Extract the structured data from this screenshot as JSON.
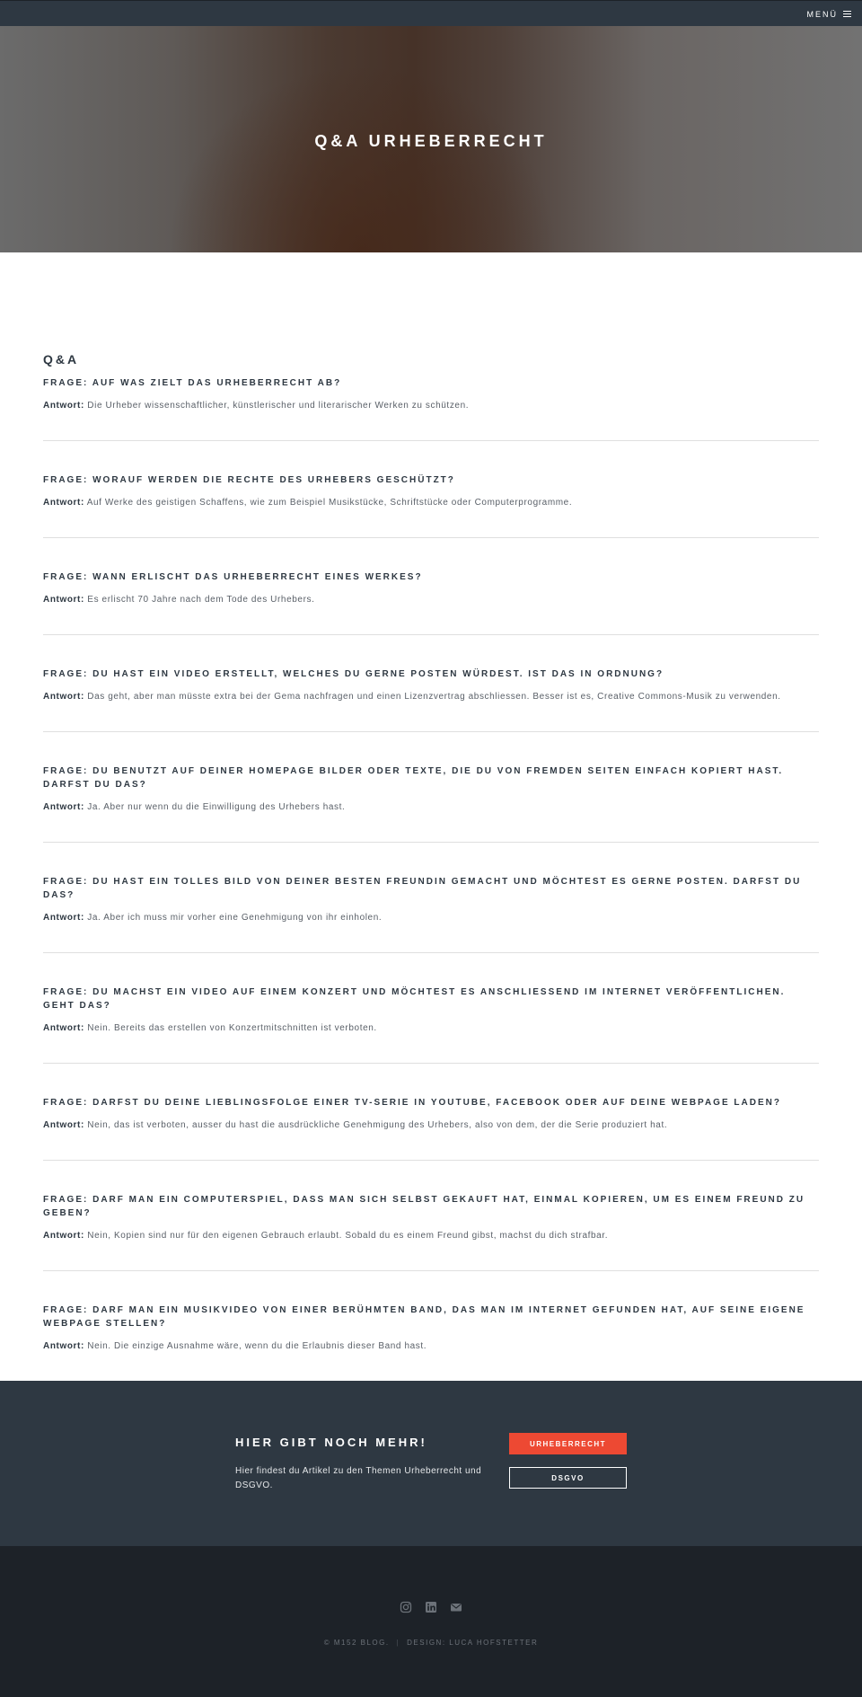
{
  "header": {
    "menu_label": "MENÜ",
    "menu_icon": "hamburger-icon"
  },
  "hero": {
    "title": "Q&A URHEBERRECHT"
  },
  "main": {
    "section_title": "Q&A",
    "answer_prefix": "Antwort:",
    "qa": [
      {
        "question": "Frage: Auf was zielt das Urheberrecht ab?",
        "answer": "Die Urheber wissenschaftlicher, künstlerischer und literarischer Werken zu schützen."
      },
      {
        "question": "Frage: Worauf werden die Rechte des Urhebers geschützt?",
        "answer": "Auf Werke des geistigen Schaffens, wie zum Beispiel Musikstücke, Schriftstücke oder Computerprogramme."
      },
      {
        "question": "Frage: Wann erlischt das Urheberrecht eines Werkes?",
        "answer": "Es erlischt 70 Jahre nach dem Tode des Urhebers."
      },
      {
        "question": "Frage: Du hast ein Video erstellt, welches du gerne posten würdest. Ist das in Ordnung?",
        "answer": "Das geht, aber man müsste extra bei der Gema nachfragen und einen Lizenzvertrag abschliessen. Besser ist es, Creative Commons-Musik zu verwenden."
      },
      {
        "question": "Frage: Du benutzt auf deiner Homepage Bilder oder Texte, die du von fremden Seiten einfach kopiert hast. Darfst du das?",
        "answer": "Ja. Aber nur wenn du die Einwilligung des Urhebers hast."
      },
      {
        "question": "Frage: Du hast ein tolles Bild von deiner besten Freundin gemacht und möchtest es gerne posten. Darfst du das?",
        "answer": "Ja. Aber ich muss mir vorher eine Genehmigung von ihr einholen."
      },
      {
        "question": "Frage: Du machst ein Video auf einem Konzert und möchtest es anschliessend im Internet veröffentlichen. Geht das?",
        "answer": "Nein. Bereits das erstellen von Konzertmitschnitten ist verboten."
      },
      {
        "question": "Frage: Darfst du deine Lieblingsfolge einer TV-Serie in Youtube, Facebook oder auf deine Webpage laden?",
        "answer": "Nein, das ist verboten, ausser du hast die ausdrückliche Genehmigung des Urhebers, also von dem, der die Serie produziert hat."
      },
      {
        "question": "Frage: Darf man ein Computerspiel, dass man sich selbst gekauft hat, einmal kopieren, um es einem Freund zu geben?",
        "answer": "Nein, Kopien sind nur für den eigenen Gebrauch erlaubt. Sobald du es einem Freund gibst, machst du dich strafbar."
      },
      {
        "question": "Frage: Darf man ein Musikvideo von einer berühmten Band, das man im Internet gefunden hat, auf seine eigene Webpage stellen?",
        "answer": "Nein. Die einzige Ausnahme wäre, wenn du die Erlaubnis dieser Band hast."
      }
    ]
  },
  "cta": {
    "title": "HIER GIBT NOCH MEHR!",
    "text": "Hier findest du Artikel zu den Themen Urheberrecht und DSGVO.",
    "primary_button": "URHEBERRECHT",
    "secondary_button": "DSGVO",
    "primary_color": "#ed4933"
  },
  "footer": {
    "social_icons": [
      "instagram-icon",
      "linkedin-icon",
      "envelope-icon"
    ],
    "copyright": "© M152 BLOG.",
    "separator": "|",
    "design_credit": "DESIGN: LUCA HOFSTETTER"
  }
}
